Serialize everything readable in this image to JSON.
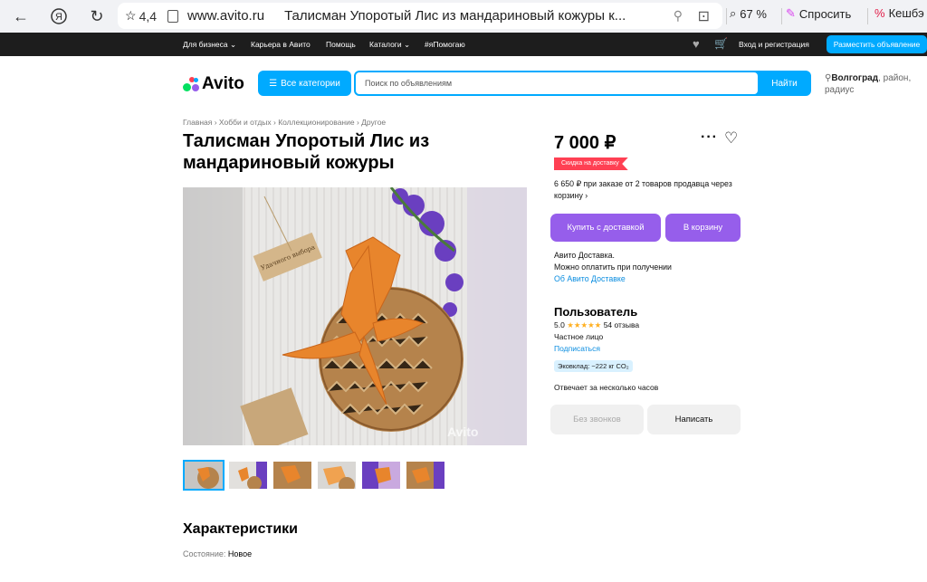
{
  "browser": {
    "back_icon": "arrow-left",
    "yandex_icon": "yandex-logo",
    "reload_icon": "reload",
    "rating": "4,4",
    "domain": "www.avito.ru",
    "page_title": "Талисман Упоротый Лис из мандариновый кожуры к...",
    "zoom": "67 %",
    "ask_label": "Спросить",
    "cashback_label": "Кешбэ"
  },
  "topnav": {
    "items": [
      "Для бизнеса ⌄",
      "Карьера в Авито",
      "Помощь",
      "Каталоги ⌄",
      "#яПомогаю"
    ],
    "login": "Вход и регистрация",
    "post_ad": "Разместить объявление"
  },
  "header": {
    "logo": "Avito",
    "categories": "Все категории",
    "search_placeholder": "Поиск по объявлениям",
    "search_button": "Найти",
    "city": "Волгоград",
    "location_rest": ", район, радиус"
  },
  "breadcrumb": "Главная › Хобби и отдых › Коллекционирование › Другое",
  "product": {
    "title": "Талисман Упоротый Лис из мандариновый кожуры",
    "watermark": "Avito",
    "tag_text": "Удачного выбора"
  },
  "sidebar": {
    "price": "7 000 ₽",
    "discount_badge": "Скидка на доставку",
    "basket_note": "6 650 ₽ при заказе от 2 товаров продавца через корзину ›",
    "buy_delivery": "Купить с доставкой",
    "add_to_cart": "В корзину",
    "delivery_line1": "Авито Доставка.",
    "delivery_line2": "Можно оплатить при получении",
    "delivery_link": "Об Авито Доставке",
    "seller_name": "Пользователь",
    "rating_value": "5.0",
    "stars": "★★★★★",
    "reviews": "54 отзыва",
    "seller_type": "Частное лицо",
    "subscribe": "Подписаться",
    "eco": "Эковклад: −222 кг CO₂",
    "reply_time": "Отвечает за несколько часов",
    "no_calls": "Без звонков",
    "write": "Написать"
  },
  "specs": {
    "title": "Характеристики",
    "condition_label": "Состояние: ",
    "condition_value": "Новое"
  },
  "colors": {
    "accent": "#00aaff",
    "purple": "#965eeb",
    "discount": "#ff4053",
    "link": "#0a8de0"
  }
}
